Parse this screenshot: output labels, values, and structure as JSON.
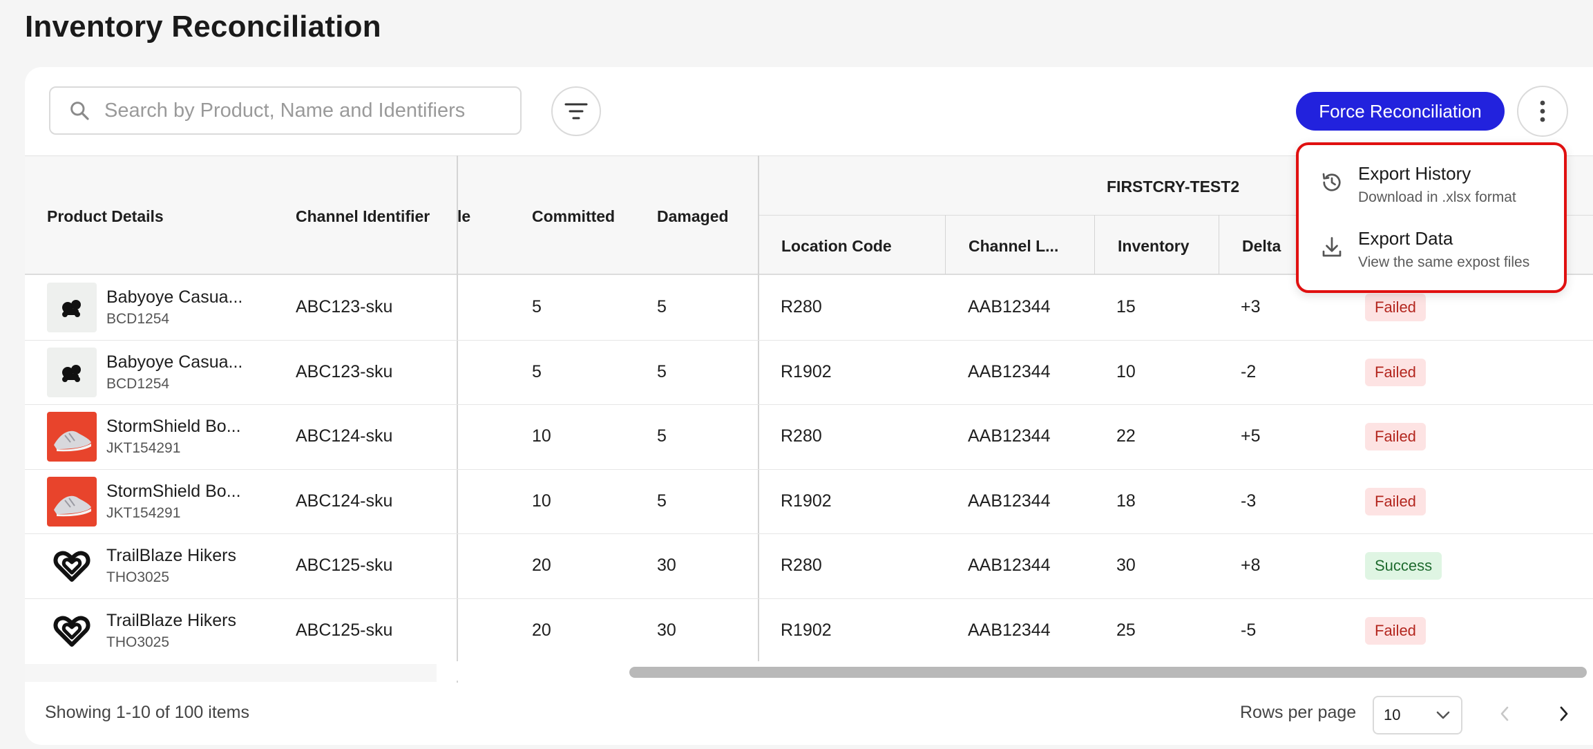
{
  "page": {
    "title": "Inventory Reconciliation"
  },
  "toolbar": {
    "search_placeholder": "Search by Product, Name and Identifiers",
    "force_label": "Force Reconciliation"
  },
  "table": {
    "group_header": "FIRSTCRY-TEST2",
    "columns": {
      "product": "Product Details",
      "channel_identifier": "Channel Identifier",
      "available_partial": "le",
      "committed": "Committed",
      "damaged": "Damaged",
      "location_code": "Location Code",
      "channel_l": "Channel L...",
      "inventory": "Inventory",
      "delta": "Delta"
    },
    "rows": [
      {
        "name": "Babyoye Casua...",
        "code": "BCD1254",
        "thumb": "dark-toy",
        "channel_id": "ABC123-sku",
        "committed": "5",
        "damaged": "5",
        "location": "R280",
        "channel_l": "AAB12344",
        "inventory": "15",
        "delta": "+3",
        "status": "Failed"
      },
      {
        "name": "Babyoye Casua...",
        "code": "BCD1254",
        "thumb": "dark-toy",
        "channel_id": "ABC123-sku",
        "committed": "5",
        "damaged": "5",
        "location": "R1902",
        "channel_l": "AAB12344",
        "inventory": "10",
        "delta": "-2",
        "status": "Failed"
      },
      {
        "name": "StormShield Bo...",
        "code": "JKT154291",
        "thumb": "red-shoe",
        "channel_id": "ABC124-sku",
        "committed": "10",
        "damaged": "5",
        "location": "R280",
        "channel_l": "AAB12344",
        "inventory": "22",
        "delta": "+5",
        "status": "Failed"
      },
      {
        "name": "StormShield Bo...",
        "code": "JKT154291",
        "thumb": "red-shoe",
        "channel_id": "ABC124-sku",
        "committed": "10",
        "damaged": "5",
        "location": "R1902",
        "channel_l": "AAB12344",
        "inventory": "18",
        "delta": "-3",
        "status": "Failed"
      },
      {
        "name": "TrailBlaze Hikers",
        "code": "THO3025",
        "thumb": "heart-logo",
        "channel_id": "ABC125-sku",
        "committed": "20",
        "damaged": "30",
        "location": "R280",
        "channel_l": "AAB12344",
        "inventory": "30",
        "delta": "+8",
        "status": "Success"
      },
      {
        "name": "TrailBlaze Hikers",
        "code": "THO3025",
        "thumb": "heart-logo",
        "channel_id": "ABC125-sku",
        "committed": "20",
        "damaged": "30",
        "location": "R1902",
        "channel_l": "AAB12344",
        "inventory": "25",
        "delta": "-5",
        "status": "Failed"
      }
    ]
  },
  "footer": {
    "showing": "Showing 1-10 of 100 items",
    "rows_per_page_label": "Rows per page",
    "rows_per_page_value": "10"
  },
  "menu": {
    "items": [
      {
        "title": "Export History",
        "subtitle": "Download in .xlsx format",
        "icon": "history-icon"
      },
      {
        "title": "Export Data",
        "subtitle": "View the same expost files",
        "icon": "download-icon"
      }
    ]
  },
  "colors": {
    "accent": "#2222dd",
    "highlight_border": "#e01010",
    "failed_bg": "#fde3e3",
    "failed_text": "#b3261e",
    "success_bg": "#dff5e3",
    "success_text": "#1e6b2e"
  }
}
